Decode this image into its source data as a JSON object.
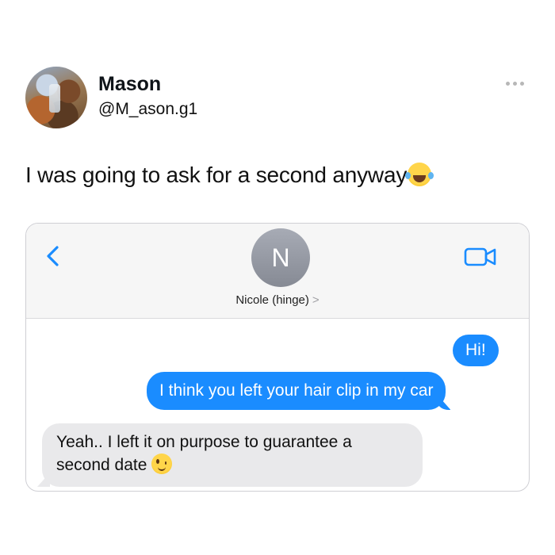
{
  "post": {
    "author_name": "Mason",
    "author_handle": "@M_ason.g1",
    "text": "I was going to ask for a second anyway",
    "text_emoji": "face-with-tears-of-joy-icon",
    "more_icon": "more-horizontal-icon"
  },
  "conversation": {
    "back_icon": "chevron-left-icon",
    "contact_initial": "N",
    "contact_name": "Nicole (hinge)",
    "contact_chevron": ">",
    "video_icon": "video-camera-icon",
    "accent_color": "#1a8cff",
    "messages": [
      {
        "side": "sent",
        "text": "Hi!"
      },
      {
        "side": "sent",
        "text": "I think you left your hair clip in my car"
      },
      {
        "side": "received",
        "text": "Yeah.. I left it on purpose to guarantee a second date",
        "emoji": "winking-face-icon"
      }
    ]
  }
}
